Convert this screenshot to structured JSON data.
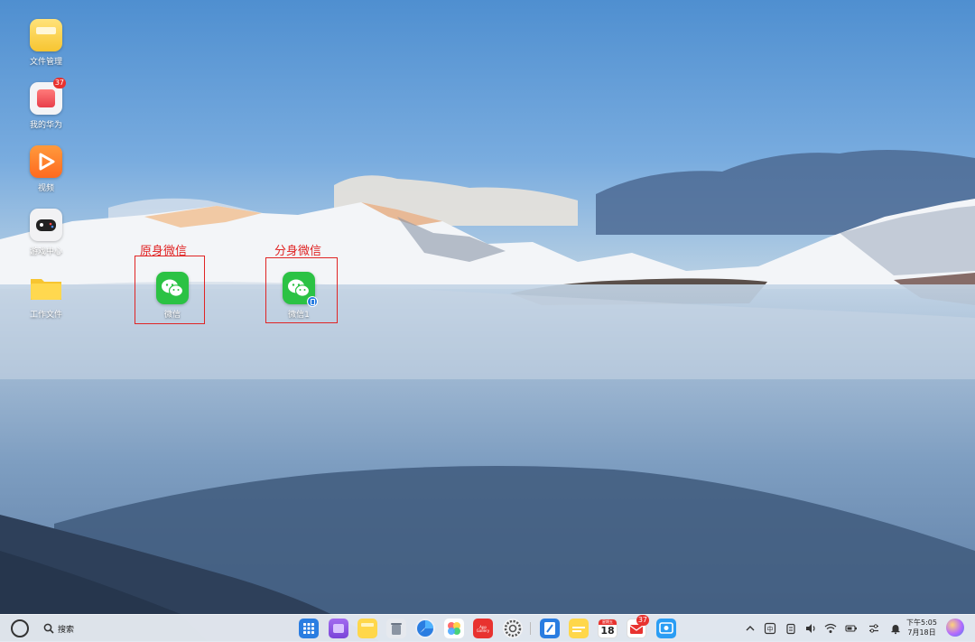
{
  "desktop": {
    "icons": [
      {
        "label": "文件管理",
        "icon": "file-manager-icon"
      },
      {
        "label": "我的华为",
        "icon": "my-huawei-icon",
        "badge": "37"
      },
      {
        "label": "视频",
        "icon": "video-icon"
      },
      {
        "label": "游戏中心",
        "icon": "game-center-icon"
      },
      {
        "label": "工作文件",
        "icon": "folder-icon"
      },
      {
        "label": "微信",
        "icon": "wechat-icon"
      },
      {
        "label": "微信1",
        "icon": "wechat-clone-icon"
      }
    ],
    "annotations": [
      "原身微信",
      "分身微信"
    ]
  },
  "taskbar": {
    "search_label": "搜索",
    "calendar_day": "18",
    "calendar_header": "星期五",
    "mail_badge": "37",
    "appgallery_label": "App Gallery",
    "clock": {
      "time": "下午5:05",
      "date": "7月18日"
    },
    "dock_apps": [
      "start-grid-icon",
      "multitask-icon",
      "notes-icon",
      "trash-icon",
      "browser-icon",
      "gallery-icon",
      "appgallery-icon",
      "settings-icon",
      "docs-icon",
      "memo-icon",
      "calendar-icon",
      "mail-icon",
      "screenshot-icon"
    ],
    "tray_icons": [
      "chevron-up-icon",
      "input-method-icon",
      "clipboard-icon",
      "volume-icon",
      "wifi-icon",
      "battery-icon",
      "control-center-icon",
      "notification-bell-icon",
      "avatar"
    ]
  },
  "colors": {
    "annotation": "#e02424",
    "wechat_green": "#2bc244",
    "accent_blue": "#2a7de1"
  }
}
